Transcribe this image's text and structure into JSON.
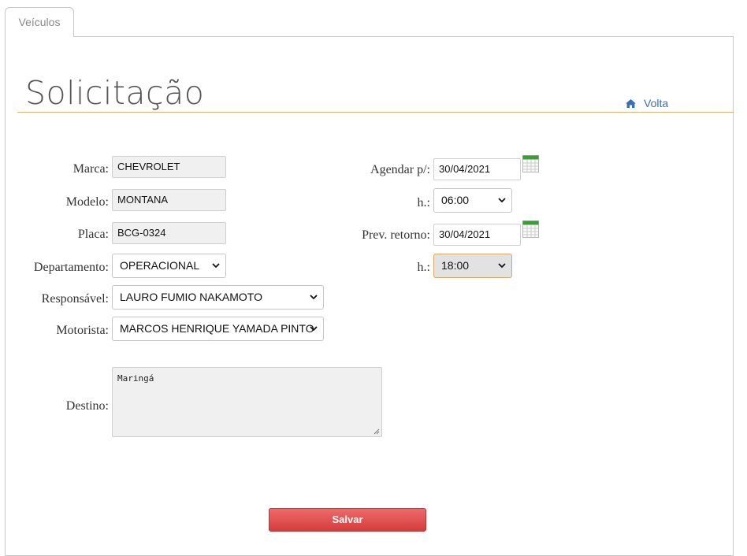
{
  "tab": {
    "label": "Veículos"
  },
  "page": {
    "title": "Solicitação"
  },
  "nav": {
    "back_label": "Volta",
    "back_icon": "home-icon"
  },
  "colors": {
    "accent_rule": "#e0b070",
    "link": "#3a6fb0",
    "save_button": "#d53c3c"
  },
  "form": {
    "marca": {
      "label": "Marca:",
      "value": "CHEVROLET"
    },
    "modelo": {
      "label": "Modelo:",
      "value": "MONTANA"
    },
    "placa": {
      "label": "Placa:",
      "value": "BCG-0324"
    },
    "departamento": {
      "label": "Departamento:",
      "value": "OPERACIONAL"
    },
    "responsavel": {
      "label": "Responsável:",
      "value": "LAURO FUMIO NAKAMOTO"
    },
    "motorista": {
      "label": "Motorista:",
      "value": "MARCOS HENRIQUE YAMADA PINTO"
    },
    "destino": {
      "label": "Destino:",
      "value": "Maringá"
    },
    "agendar": {
      "label": "Agendar p/:",
      "value": "30/04/2021",
      "icon": "calendar-icon"
    },
    "agendar_hora": {
      "label": "h.:",
      "value": "06:00"
    },
    "retorno": {
      "label": "Prev. retorno:",
      "value": "30/04/2021",
      "icon": "calendar-icon"
    },
    "retorno_hora": {
      "label": "h.:",
      "value": "18:00"
    }
  },
  "actions": {
    "save_label": "Salvar"
  }
}
